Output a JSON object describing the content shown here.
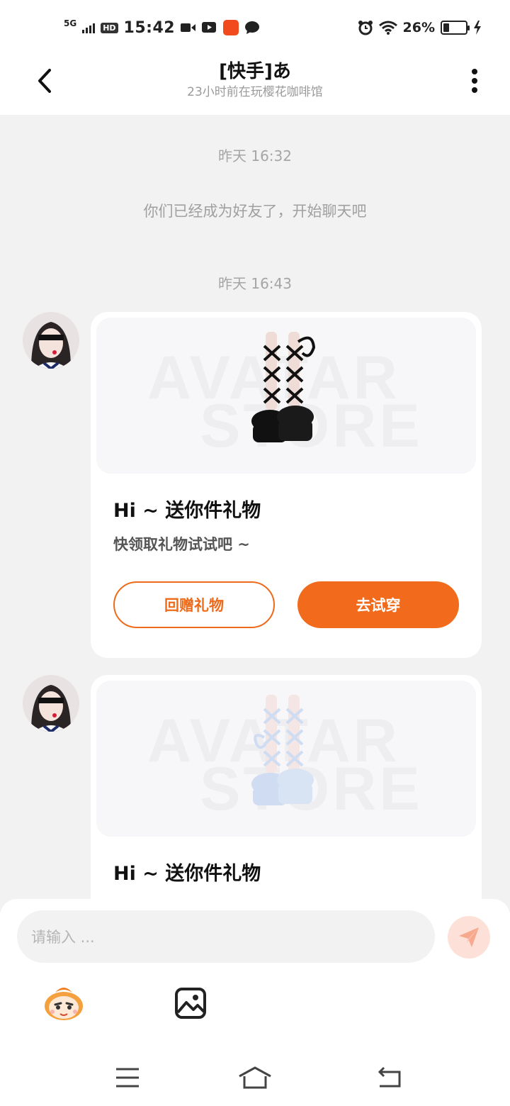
{
  "status_bar": {
    "network": "5G",
    "hd": "HD",
    "time": "15:42",
    "battery_percent": "26%",
    "battery_level": 0.26,
    "icons": [
      "signal-icon",
      "video-icon",
      "video-play-icon",
      "app-icon",
      "message-icon",
      "alarm-icon",
      "wifi-icon",
      "battery-icon",
      "charging-icon"
    ]
  },
  "header": {
    "title": "[快手]あ",
    "subtitle": "23小时前在玩樱花咖啡馆",
    "icons": [
      "back-icon",
      "more-icon"
    ]
  },
  "chat": {
    "time_1": "昨天 16:32",
    "system_message": "你们已经成为好友了，开始聊天吧",
    "time_2": "昨天 16:43",
    "cards": [
      {
        "watermark_1": "AVATAR",
        "watermark_2": "STORE",
        "title": "Hi ~ 送你件礼物",
        "desc": "快领取礼物试试吧 ~",
        "button_gift_back": "回赠礼物",
        "button_try_on": "去试穿",
        "shoe_color": "#111111"
      },
      {
        "watermark_1": "AVATAR",
        "watermark_2": "STORE",
        "title": "Hi ~ 送你件礼物",
        "shoe_color": "#cfdcf1"
      }
    ]
  },
  "input": {
    "placeholder": "请输入 ...",
    "icons": [
      "send-icon",
      "emoji-mascot-icon",
      "image-icon"
    ]
  },
  "nav": {
    "icons": [
      "menu-icon",
      "home-icon",
      "back-nav-icon"
    ]
  },
  "colors": {
    "accent": "#f26a1b",
    "background": "#f2f2f3"
  }
}
